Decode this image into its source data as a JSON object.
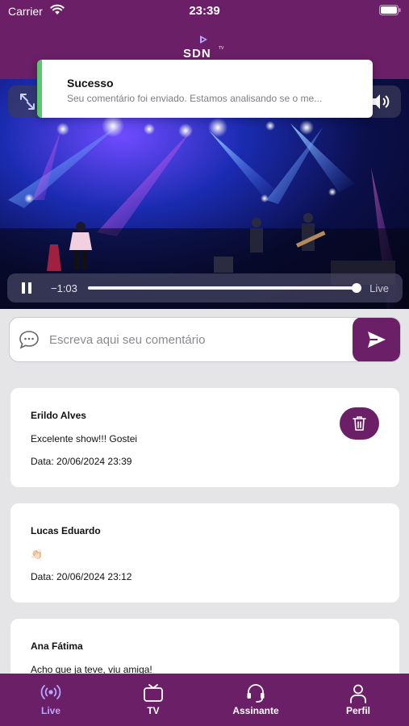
{
  "status_bar": {
    "carrier": "Carrier",
    "time": "23:39"
  },
  "header": {
    "logo_text": "SDN",
    "logo_badge": "TV"
  },
  "toast": {
    "title": "Sucesso",
    "message": "Seu comentário foi enviado. Estamos analisando se o me...",
    "accent_color": "#5cc86e"
  },
  "player": {
    "time_remaining": "−1:03",
    "live_label": "Live",
    "progress": 0.99,
    "expand_icon": "expand-icon",
    "volume_icon": "volume-icon"
  },
  "comment_input": {
    "placeholder": "Escreva aqui seu comentário",
    "value": ""
  },
  "comments": [
    {
      "author": "Erildo Alves",
      "text": "Excelente show!!! Gostei",
      "date": "Data: 20/06/2024 23:39",
      "deletable": true
    },
    {
      "author": "Lucas Eduardo",
      "text": "👏🏻",
      "date": "Data: 20/06/2024 23:12",
      "deletable": false
    },
    {
      "author": "Ana Fátima",
      "text": "Acho que ja teve, viu amiga!",
      "date": "",
      "deletable": false
    }
  ],
  "tabbar": {
    "active": "Live",
    "items": [
      {
        "label": "Live",
        "icon": "broadcast-icon"
      },
      {
        "label": "TV",
        "icon": "tv-icon"
      },
      {
        "label": "Assinante",
        "icon": "headset-icon"
      },
      {
        "label": "Perfil",
        "icon": "person-icon"
      }
    ]
  },
  "colors": {
    "brand": "#6b1f66",
    "active_tab": "#b9a7ff",
    "background": "#e5e5e7"
  }
}
